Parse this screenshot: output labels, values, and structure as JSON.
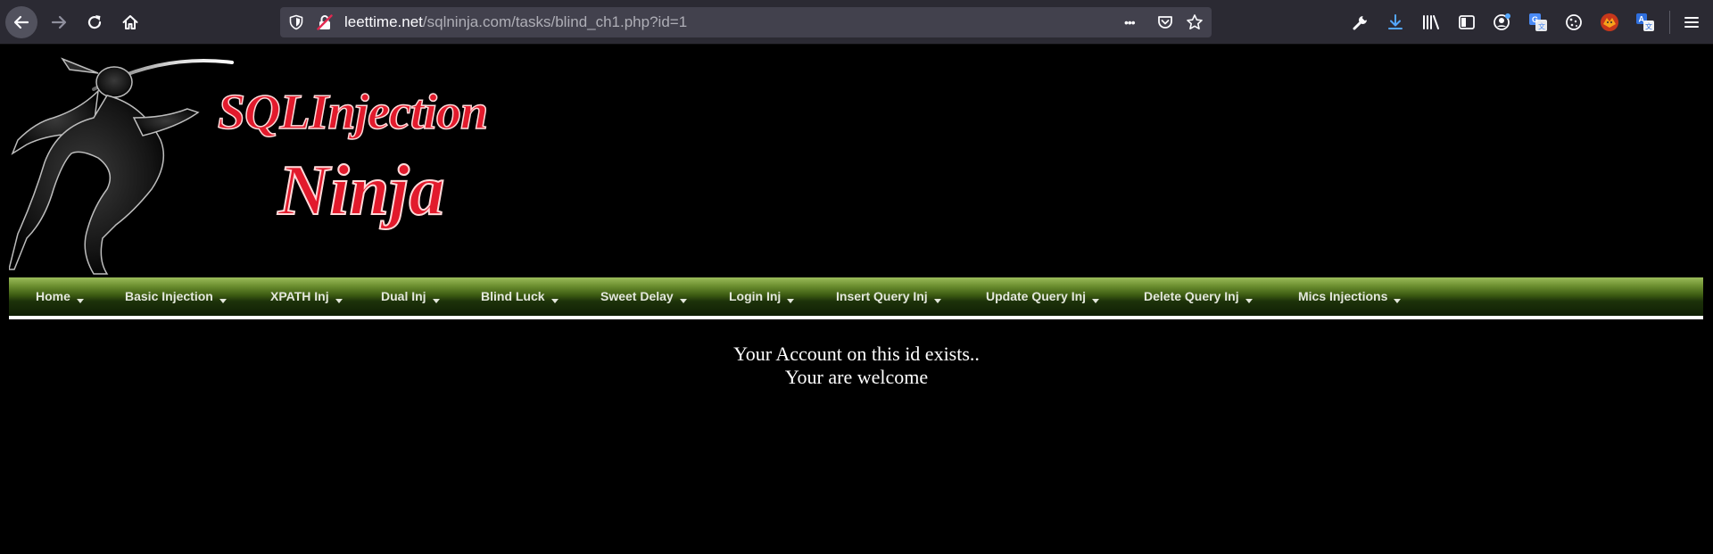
{
  "browser": {
    "url_domain": "leettime.net",
    "url_path": "/sqlninja.com/tasks/blind_ch1.php?id=1",
    "more_glyph": "•••"
  },
  "banner": {
    "line1": "SQLInjection",
    "line2": "Ninja",
    "colors": {
      "text": "#e21a2c",
      "outline": "#ffd9d9"
    }
  },
  "nav": {
    "items": [
      {
        "label": "Home"
      },
      {
        "label": "Basic Injection"
      },
      {
        "label": "XPATH Inj"
      },
      {
        "label": "Dual Inj"
      },
      {
        "label": "Blind Luck"
      },
      {
        "label": "Sweet Delay"
      },
      {
        "label": "Login Inj"
      },
      {
        "label": "Insert Query Inj"
      },
      {
        "label": "Update Query Inj"
      },
      {
        "label": "Delete Query Inj"
      },
      {
        "label": "Mics Injections"
      }
    ],
    "colors": {
      "top": "#9bbc5a",
      "bottom": "#0f1f04"
    }
  },
  "content": {
    "line1": "Your Account on this id exists..",
    "line2": "Your are welcome"
  },
  "icons": {
    "toolbar": [
      "back-arrow-icon",
      "forward-arrow-icon",
      "reload-icon",
      "home-icon"
    ],
    "urlbar": [
      "tracking-shield-icon",
      "insecure-lock-icon",
      "more-actions-icon",
      "pocket-icon",
      "bookmark-star-icon"
    ],
    "extensions": [
      "wrench-icon",
      "download-icon",
      "library-icon",
      "sidebar-icon",
      "account-icon",
      "translate-icon",
      "cookie-icon",
      "fox-extension-icon",
      "language-icon",
      "menu-icon"
    ]
  }
}
